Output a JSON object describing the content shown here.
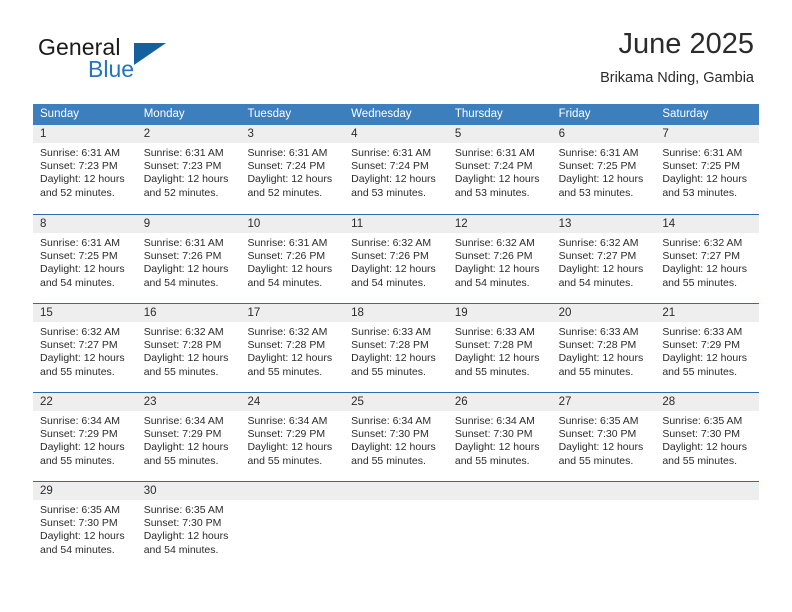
{
  "brand": {
    "word_one": "General",
    "word_two": "Blue",
    "triangle_icon": "triangle-icon",
    "accent_blue": "#2275c3",
    "triangle_blue": "#15619f"
  },
  "header": {
    "title": "June 2025",
    "subtitle": "Brikama Nding, Gambia"
  },
  "theme": {
    "header_row_bg": "#3d7ebd",
    "row_divider": "#2e6da8",
    "day_band_bg": "#eeeeee",
    "text": "#2b2b2b"
  },
  "weekdays": [
    "Sunday",
    "Monday",
    "Tuesday",
    "Wednesday",
    "Thursday",
    "Friday",
    "Saturday"
  ],
  "weeks": [
    [
      {
        "day": "1",
        "sunrise": "Sunrise: 6:31 AM",
        "sunset": "Sunset: 7:23 PM",
        "daylight_line1": "Daylight: 12 hours",
        "daylight_line2": "and 52 minutes."
      },
      {
        "day": "2",
        "sunrise": "Sunrise: 6:31 AM",
        "sunset": "Sunset: 7:23 PM",
        "daylight_line1": "Daylight: 12 hours",
        "daylight_line2": "and 52 minutes."
      },
      {
        "day": "3",
        "sunrise": "Sunrise: 6:31 AM",
        "sunset": "Sunset: 7:24 PM",
        "daylight_line1": "Daylight: 12 hours",
        "daylight_line2": "and 52 minutes."
      },
      {
        "day": "4",
        "sunrise": "Sunrise: 6:31 AM",
        "sunset": "Sunset: 7:24 PM",
        "daylight_line1": "Daylight: 12 hours",
        "daylight_line2": "and 53 minutes."
      },
      {
        "day": "5",
        "sunrise": "Sunrise: 6:31 AM",
        "sunset": "Sunset: 7:24 PM",
        "daylight_line1": "Daylight: 12 hours",
        "daylight_line2": "and 53 minutes."
      },
      {
        "day": "6",
        "sunrise": "Sunrise: 6:31 AM",
        "sunset": "Sunset: 7:25 PM",
        "daylight_line1": "Daylight: 12 hours",
        "daylight_line2": "and 53 minutes."
      },
      {
        "day": "7",
        "sunrise": "Sunrise: 6:31 AM",
        "sunset": "Sunset: 7:25 PM",
        "daylight_line1": "Daylight: 12 hours",
        "daylight_line2": "and 53 minutes."
      }
    ],
    [
      {
        "day": "8",
        "sunrise": "Sunrise: 6:31 AM",
        "sunset": "Sunset: 7:25 PM",
        "daylight_line1": "Daylight: 12 hours",
        "daylight_line2": "and 54 minutes."
      },
      {
        "day": "9",
        "sunrise": "Sunrise: 6:31 AM",
        "sunset": "Sunset: 7:26 PM",
        "daylight_line1": "Daylight: 12 hours",
        "daylight_line2": "and 54 minutes."
      },
      {
        "day": "10",
        "sunrise": "Sunrise: 6:31 AM",
        "sunset": "Sunset: 7:26 PM",
        "daylight_line1": "Daylight: 12 hours",
        "daylight_line2": "and 54 minutes."
      },
      {
        "day": "11",
        "sunrise": "Sunrise: 6:32 AM",
        "sunset": "Sunset: 7:26 PM",
        "daylight_line1": "Daylight: 12 hours",
        "daylight_line2": "and 54 minutes."
      },
      {
        "day": "12",
        "sunrise": "Sunrise: 6:32 AM",
        "sunset": "Sunset: 7:26 PM",
        "daylight_line1": "Daylight: 12 hours",
        "daylight_line2": "and 54 minutes."
      },
      {
        "day": "13",
        "sunrise": "Sunrise: 6:32 AM",
        "sunset": "Sunset: 7:27 PM",
        "daylight_line1": "Daylight: 12 hours",
        "daylight_line2": "and 54 minutes."
      },
      {
        "day": "14",
        "sunrise": "Sunrise: 6:32 AM",
        "sunset": "Sunset: 7:27 PM",
        "daylight_line1": "Daylight: 12 hours",
        "daylight_line2": "and 55 minutes."
      }
    ],
    [
      {
        "day": "15",
        "sunrise": "Sunrise: 6:32 AM",
        "sunset": "Sunset: 7:27 PM",
        "daylight_line1": "Daylight: 12 hours",
        "daylight_line2": "and 55 minutes."
      },
      {
        "day": "16",
        "sunrise": "Sunrise: 6:32 AM",
        "sunset": "Sunset: 7:28 PM",
        "daylight_line1": "Daylight: 12 hours",
        "daylight_line2": "and 55 minutes."
      },
      {
        "day": "17",
        "sunrise": "Sunrise: 6:32 AM",
        "sunset": "Sunset: 7:28 PM",
        "daylight_line1": "Daylight: 12 hours",
        "daylight_line2": "and 55 minutes."
      },
      {
        "day": "18",
        "sunrise": "Sunrise: 6:33 AM",
        "sunset": "Sunset: 7:28 PM",
        "daylight_line1": "Daylight: 12 hours",
        "daylight_line2": "and 55 minutes."
      },
      {
        "day": "19",
        "sunrise": "Sunrise: 6:33 AM",
        "sunset": "Sunset: 7:28 PM",
        "daylight_line1": "Daylight: 12 hours",
        "daylight_line2": "and 55 minutes."
      },
      {
        "day": "20",
        "sunrise": "Sunrise: 6:33 AM",
        "sunset": "Sunset: 7:28 PM",
        "daylight_line1": "Daylight: 12 hours",
        "daylight_line2": "and 55 minutes."
      },
      {
        "day": "21",
        "sunrise": "Sunrise: 6:33 AM",
        "sunset": "Sunset: 7:29 PM",
        "daylight_line1": "Daylight: 12 hours",
        "daylight_line2": "and 55 minutes."
      }
    ],
    [
      {
        "day": "22",
        "sunrise": "Sunrise: 6:34 AM",
        "sunset": "Sunset: 7:29 PM",
        "daylight_line1": "Daylight: 12 hours",
        "daylight_line2": "and 55 minutes."
      },
      {
        "day": "23",
        "sunrise": "Sunrise: 6:34 AM",
        "sunset": "Sunset: 7:29 PM",
        "daylight_line1": "Daylight: 12 hours",
        "daylight_line2": "and 55 minutes."
      },
      {
        "day": "24",
        "sunrise": "Sunrise: 6:34 AM",
        "sunset": "Sunset: 7:29 PM",
        "daylight_line1": "Daylight: 12 hours",
        "daylight_line2": "and 55 minutes."
      },
      {
        "day": "25",
        "sunrise": "Sunrise: 6:34 AM",
        "sunset": "Sunset: 7:30 PM",
        "daylight_line1": "Daylight: 12 hours",
        "daylight_line2": "and 55 minutes."
      },
      {
        "day": "26",
        "sunrise": "Sunrise: 6:34 AM",
        "sunset": "Sunset: 7:30 PM",
        "daylight_line1": "Daylight: 12 hours",
        "daylight_line2": "and 55 minutes."
      },
      {
        "day": "27",
        "sunrise": "Sunrise: 6:35 AM",
        "sunset": "Sunset: 7:30 PM",
        "daylight_line1": "Daylight: 12 hours",
        "daylight_line2": "and 55 minutes."
      },
      {
        "day": "28",
        "sunrise": "Sunrise: 6:35 AM",
        "sunset": "Sunset: 7:30 PM",
        "daylight_line1": "Daylight: 12 hours",
        "daylight_line2": "and 55 minutes."
      }
    ],
    [
      {
        "day": "29",
        "sunrise": "Sunrise: 6:35 AM",
        "sunset": "Sunset: 7:30 PM",
        "daylight_line1": "Daylight: 12 hours",
        "daylight_line2": "and 54 minutes."
      },
      {
        "day": "30",
        "sunrise": "Sunrise: 6:35 AM",
        "sunset": "Sunset: 7:30 PM",
        "daylight_line1": "Daylight: 12 hours",
        "daylight_line2": "and 54 minutes."
      },
      {
        "day": "",
        "sunrise": "",
        "sunset": "",
        "daylight_line1": "",
        "daylight_line2": ""
      },
      {
        "day": "",
        "sunrise": "",
        "sunset": "",
        "daylight_line1": "",
        "daylight_line2": ""
      },
      {
        "day": "",
        "sunrise": "",
        "sunset": "",
        "daylight_line1": "",
        "daylight_line2": ""
      },
      {
        "day": "",
        "sunrise": "",
        "sunset": "",
        "daylight_line1": "",
        "daylight_line2": ""
      },
      {
        "day": "",
        "sunrise": "",
        "sunset": "",
        "daylight_line1": "",
        "daylight_line2": ""
      }
    ]
  ]
}
